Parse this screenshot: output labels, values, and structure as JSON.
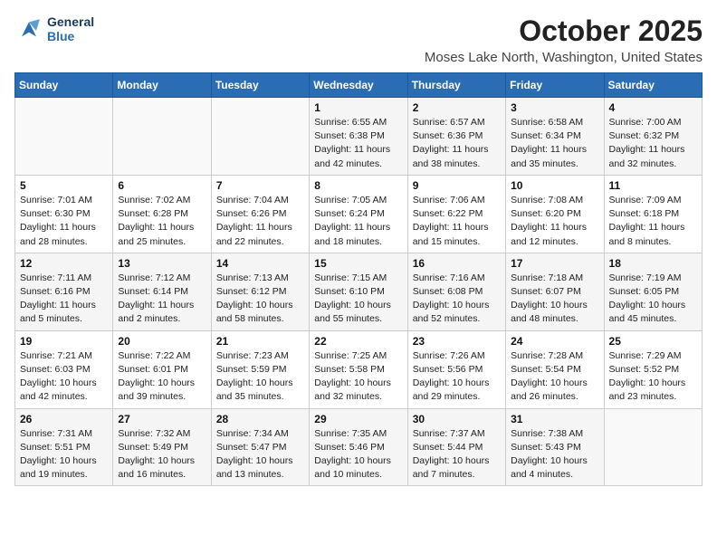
{
  "header": {
    "logo_line1": "General",
    "logo_line2": "Blue",
    "month": "October 2025",
    "location": "Moses Lake North, Washington, United States"
  },
  "weekdays": [
    "Sunday",
    "Monday",
    "Tuesday",
    "Wednesday",
    "Thursday",
    "Friday",
    "Saturday"
  ],
  "weeks": [
    [
      {
        "day": "",
        "info": ""
      },
      {
        "day": "",
        "info": ""
      },
      {
        "day": "",
        "info": ""
      },
      {
        "day": "1",
        "info": "Sunrise: 6:55 AM\nSunset: 6:38 PM\nDaylight: 11 hours\nand 42 minutes."
      },
      {
        "day": "2",
        "info": "Sunrise: 6:57 AM\nSunset: 6:36 PM\nDaylight: 11 hours\nand 38 minutes."
      },
      {
        "day": "3",
        "info": "Sunrise: 6:58 AM\nSunset: 6:34 PM\nDaylight: 11 hours\nand 35 minutes."
      },
      {
        "day": "4",
        "info": "Sunrise: 7:00 AM\nSunset: 6:32 PM\nDaylight: 11 hours\nand 32 minutes."
      }
    ],
    [
      {
        "day": "5",
        "info": "Sunrise: 7:01 AM\nSunset: 6:30 PM\nDaylight: 11 hours\nand 28 minutes."
      },
      {
        "day": "6",
        "info": "Sunrise: 7:02 AM\nSunset: 6:28 PM\nDaylight: 11 hours\nand 25 minutes."
      },
      {
        "day": "7",
        "info": "Sunrise: 7:04 AM\nSunset: 6:26 PM\nDaylight: 11 hours\nand 22 minutes."
      },
      {
        "day": "8",
        "info": "Sunrise: 7:05 AM\nSunset: 6:24 PM\nDaylight: 11 hours\nand 18 minutes."
      },
      {
        "day": "9",
        "info": "Sunrise: 7:06 AM\nSunset: 6:22 PM\nDaylight: 11 hours\nand 15 minutes."
      },
      {
        "day": "10",
        "info": "Sunrise: 7:08 AM\nSunset: 6:20 PM\nDaylight: 11 hours\nand 12 minutes."
      },
      {
        "day": "11",
        "info": "Sunrise: 7:09 AM\nSunset: 6:18 PM\nDaylight: 11 hours\nand 8 minutes."
      }
    ],
    [
      {
        "day": "12",
        "info": "Sunrise: 7:11 AM\nSunset: 6:16 PM\nDaylight: 11 hours\nand 5 minutes."
      },
      {
        "day": "13",
        "info": "Sunrise: 7:12 AM\nSunset: 6:14 PM\nDaylight: 11 hours\nand 2 minutes."
      },
      {
        "day": "14",
        "info": "Sunrise: 7:13 AM\nSunset: 6:12 PM\nDaylight: 10 hours\nand 58 minutes."
      },
      {
        "day": "15",
        "info": "Sunrise: 7:15 AM\nSunset: 6:10 PM\nDaylight: 10 hours\nand 55 minutes."
      },
      {
        "day": "16",
        "info": "Sunrise: 7:16 AM\nSunset: 6:08 PM\nDaylight: 10 hours\nand 52 minutes."
      },
      {
        "day": "17",
        "info": "Sunrise: 7:18 AM\nSunset: 6:07 PM\nDaylight: 10 hours\nand 48 minutes."
      },
      {
        "day": "18",
        "info": "Sunrise: 7:19 AM\nSunset: 6:05 PM\nDaylight: 10 hours\nand 45 minutes."
      }
    ],
    [
      {
        "day": "19",
        "info": "Sunrise: 7:21 AM\nSunset: 6:03 PM\nDaylight: 10 hours\nand 42 minutes."
      },
      {
        "day": "20",
        "info": "Sunrise: 7:22 AM\nSunset: 6:01 PM\nDaylight: 10 hours\nand 39 minutes."
      },
      {
        "day": "21",
        "info": "Sunrise: 7:23 AM\nSunset: 5:59 PM\nDaylight: 10 hours\nand 35 minutes."
      },
      {
        "day": "22",
        "info": "Sunrise: 7:25 AM\nSunset: 5:58 PM\nDaylight: 10 hours\nand 32 minutes."
      },
      {
        "day": "23",
        "info": "Sunrise: 7:26 AM\nSunset: 5:56 PM\nDaylight: 10 hours\nand 29 minutes."
      },
      {
        "day": "24",
        "info": "Sunrise: 7:28 AM\nSunset: 5:54 PM\nDaylight: 10 hours\nand 26 minutes."
      },
      {
        "day": "25",
        "info": "Sunrise: 7:29 AM\nSunset: 5:52 PM\nDaylight: 10 hours\nand 23 minutes."
      }
    ],
    [
      {
        "day": "26",
        "info": "Sunrise: 7:31 AM\nSunset: 5:51 PM\nDaylight: 10 hours\nand 19 minutes."
      },
      {
        "day": "27",
        "info": "Sunrise: 7:32 AM\nSunset: 5:49 PM\nDaylight: 10 hours\nand 16 minutes."
      },
      {
        "day": "28",
        "info": "Sunrise: 7:34 AM\nSunset: 5:47 PM\nDaylight: 10 hours\nand 13 minutes."
      },
      {
        "day": "29",
        "info": "Sunrise: 7:35 AM\nSunset: 5:46 PM\nDaylight: 10 hours\nand 10 minutes."
      },
      {
        "day": "30",
        "info": "Sunrise: 7:37 AM\nSunset: 5:44 PM\nDaylight: 10 hours\nand 7 minutes."
      },
      {
        "day": "31",
        "info": "Sunrise: 7:38 AM\nSunset: 5:43 PM\nDaylight: 10 hours\nand 4 minutes."
      },
      {
        "day": "",
        "info": ""
      }
    ]
  ]
}
